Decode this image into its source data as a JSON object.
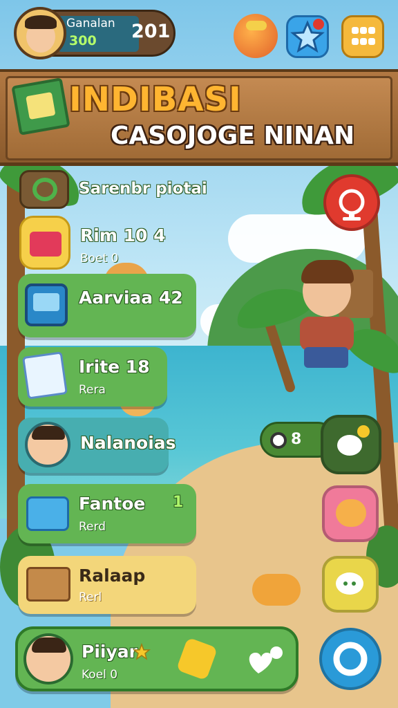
{
  "header": {
    "player_name": "Ganalan",
    "player_score": "300",
    "coins": "201"
  },
  "banner": {
    "title": "INDIBASI",
    "subtitle": "CASOJOGE NINAN"
  },
  "menu": {
    "items": [
      {
        "label": "Sarenbr piotai",
        "sub": ""
      },
      {
        "label": "Rim 10 4",
        "sub": "Boet 0"
      },
      {
        "label": "Aarviaa 42",
        "sub": ""
      },
      {
        "label": "Irite 18",
        "sub": "Rera"
      },
      {
        "label": "Nalanoias",
        "sub": ""
      },
      {
        "label": "Fantoe",
        "badge": "1",
        "sub": "Rerd"
      },
      {
        "label": "Ralaap",
        "sub": "Rerl"
      },
      {
        "label": "Piiyar",
        "sub": "Koel 0"
      }
    ]
  },
  "counter": {
    "value": "8"
  },
  "colors": {
    "wood": "#a06b36",
    "title_orange": "#ffb531",
    "item_green": "#63b553",
    "accent_red": "#e03a2e",
    "accent_blue": "#3aa4e8"
  },
  "icons": [
    "fish-icon",
    "star-icon",
    "grid-menu-icon",
    "book-icon",
    "alarm-icon",
    "chat-icon",
    "heart-icon",
    "settings-ring-icon"
  ]
}
